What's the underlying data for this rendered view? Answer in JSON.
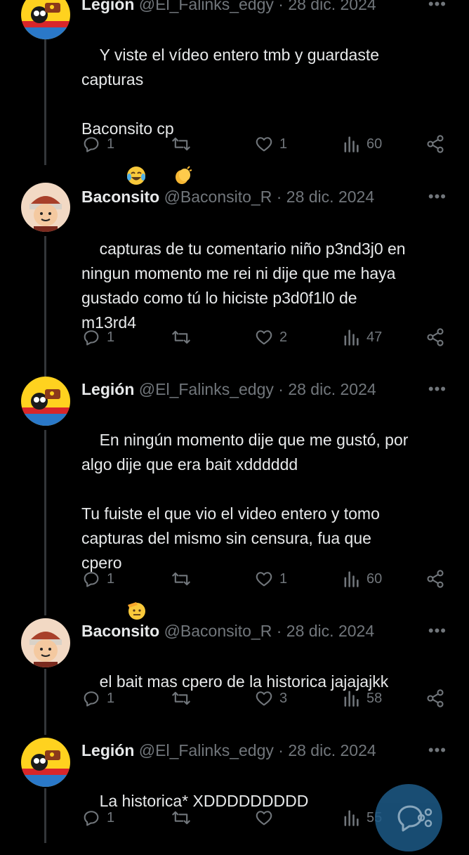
{
  "colors": {
    "background": "#000000",
    "text": "#e7e9ea",
    "muted": "#71767b",
    "thread_line": "#333639",
    "fab": "#1d5a87"
  },
  "tweets": [
    {
      "name": "Legión",
      "handle": "@El_Falinks_edgy",
      "date": "· 28 dic. 2024",
      "text": "Y viste el vídeo entero tmb y guardaste\ncapturas\n\nBaconsito cp",
      "emojis": [
        "crying-laughing",
        "clapping-hands"
      ],
      "replies": "1",
      "reposts": "",
      "likes": "1",
      "views": "60"
    },
    {
      "name": "Baconsito",
      "handle": "@Baconsito_R",
      "date": "· 28 dic. 2024",
      "text": "capturas de tu comentario niño p3nd3j0 en\nningun momento me rei ni dije que me haya\ngustado como tú lo hiciste p3d0f1l0 de\nm13rd4",
      "replies": "1",
      "reposts": "",
      "likes": "2",
      "views": "47"
    },
    {
      "name": "Legión",
      "handle": "@El_Falinks_edgy",
      "date": "· 28 dic. 2024",
      "text": "En ningún momento dije que me gustó, por\nalgo dije que era bait xdddddd\n\nTu fuiste el que vio el video entero y tomo\ncapturas del mismo sin censura, fua que\ncpero",
      "emojis": [
        "saluting-face"
      ],
      "replies": "1",
      "reposts": "",
      "likes": "1",
      "views": "60"
    },
    {
      "name": "Baconsito",
      "handle": "@Baconsito_R",
      "date": "· 28 dic. 2024",
      "text": "el bait mas cpero de la historica jajajajkk",
      "replies": "1",
      "reposts": "",
      "likes": "3",
      "views": "58"
    },
    {
      "name": "Legión",
      "handle": "@El_Falinks_edgy",
      "date": "· 28 dic. 2024",
      "text": "La historica* XDDDDDDDDD",
      "replies": "1",
      "reposts": "",
      "likes": "",
      "views": "55"
    }
  ]
}
